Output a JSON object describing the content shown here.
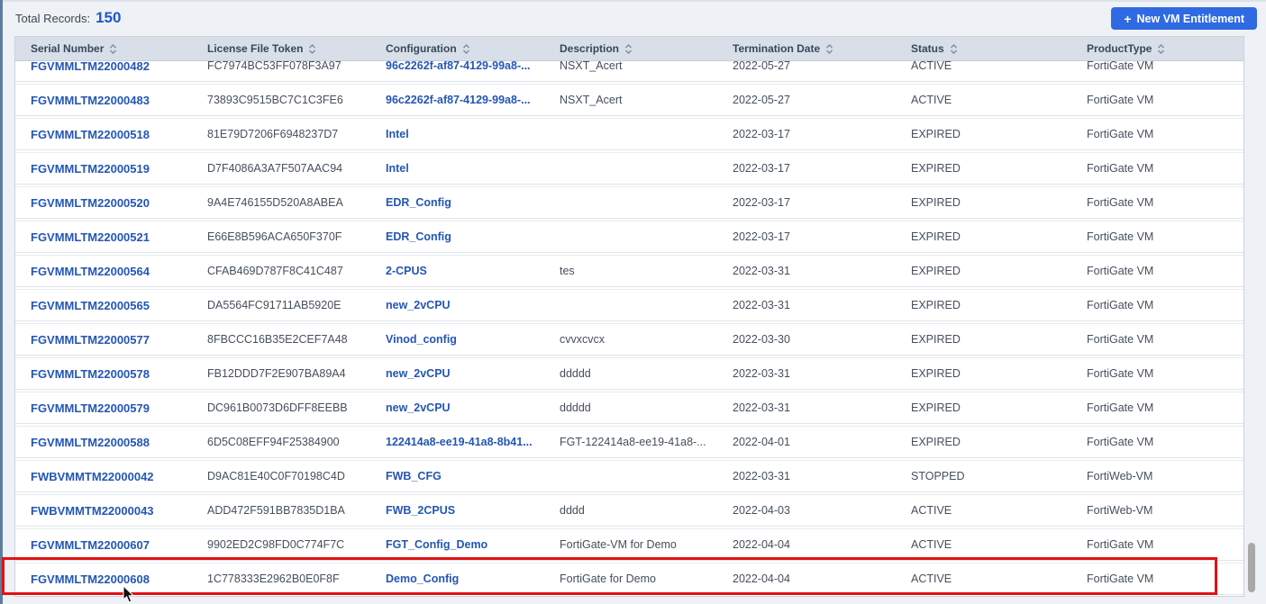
{
  "page": {
    "total_records_label": "Total Records:",
    "total_records_value": "150"
  },
  "toolbar": {
    "new_vm_entitlement_label": "New VM Entitlement"
  },
  "icons": {
    "plus": "+",
    "sort": "sort-updown-icon",
    "cursor": "mouse-arrow-icon"
  },
  "colors": {
    "accent_blue": "#2f6ae3",
    "link_blue": "#2456b4",
    "header_bg": "#d8dfe9",
    "highlight_red": "#e01212",
    "page_bg": "#eef1f5"
  },
  "table": {
    "columns": [
      {
        "key": "serial",
        "label": "Serial Number",
        "sortable": true
      },
      {
        "key": "token",
        "label": "License File Token",
        "sortable": true
      },
      {
        "key": "config",
        "label": "Configuration",
        "sortable": true
      },
      {
        "key": "desc",
        "label": "Description",
        "sortable": true
      },
      {
        "key": "date",
        "label": "Termination Date",
        "sortable": true
      },
      {
        "key": "status",
        "label": "Status",
        "sortable": true
      },
      {
        "key": "product",
        "label": "ProductType",
        "sortable": true
      }
    ],
    "rows": [
      {
        "serial": "FGVMMLTM22000482",
        "token": "FC7974BC53FF078F3A97",
        "config": "96c2262f-af87-4129-99a8-...",
        "desc": "NSXT_Acert",
        "date": "2022-05-27",
        "status": "ACTIVE",
        "product": "FortiGate VM"
      },
      {
        "serial": "FGVMMLTM22000483",
        "token": "73893C9515BC7C1C3FE6",
        "config": "96c2262f-af87-4129-99a8-...",
        "desc": "NSXT_Acert",
        "date": "2022-05-27",
        "status": "ACTIVE",
        "product": "FortiGate VM"
      },
      {
        "serial": "FGVMMLTM22000518",
        "token": "81E79D7206F6948237D7",
        "config": "Intel",
        "desc": "",
        "date": "2022-03-17",
        "status": "EXPIRED",
        "product": "FortiGate VM"
      },
      {
        "serial": "FGVMMLTM22000519",
        "token": "D7F4086A3A7F507AAC94",
        "config": "Intel",
        "desc": "",
        "date": "2022-03-17",
        "status": "EXPIRED",
        "product": "FortiGate VM"
      },
      {
        "serial": "FGVMMLTM22000520",
        "token": "9A4E746155D520A8ABEA",
        "config": "EDR_Config",
        "desc": "",
        "date": "2022-03-17",
        "status": "EXPIRED",
        "product": "FortiGate VM"
      },
      {
        "serial": "FGVMMLTM22000521",
        "token": "E66E8B596ACA650F370F",
        "config": "EDR_Config",
        "desc": "",
        "date": "2022-03-17",
        "status": "EXPIRED",
        "product": "FortiGate VM"
      },
      {
        "serial": "FGVMMLTM22000564",
        "token": "CFAB469D787F8C41C487",
        "config": "2-CPUS",
        "desc": "tes",
        "date": "2022-03-31",
        "status": "EXPIRED",
        "product": "FortiGate VM"
      },
      {
        "serial": "FGVMMLTM22000565",
        "token": "DA5564FC91711AB5920E",
        "config": "new_2vCPU",
        "desc": "",
        "date": "2022-03-31",
        "status": "EXPIRED",
        "product": "FortiGate VM"
      },
      {
        "serial": "FGVMMLTM22000577",
        "token": "8FBCCC16B35E2CEF7A48",
        "config": "Vinod_config",
        "desc": "cvvxcvcx",
        "date": "2022-03-30",
        "status": "EXPIRED",
        "product": "FortiGate VM"
      },
      {
        "serial": "FGVMMLTM22000578",
        "token": "FB12DDD7F2E907BA89A4",
        "config": "new_2vCPU",
        "desc": "ddddd",
        "date": "2022-03-31",
        "status": "EXPIRED",
        "product": "FortiGate VM"
      },
      {
        "serial": "FGVMMLTM22000579",
        "token": "DC961B0073D6DFF8EEBB",
        "config": "new_2vCPU",
        "desc": "ddddd",
        "date": "2022-03-31",
        "status": "EXPIRED",
        "product": "FortiGate VM"
      },
      {
        "serial": "FGVMMLTM22000588",
        "token": "6D5C08EFF94F25384900",
        "config": "122414a8-ee19-41a8-8b41...",
        "desc": "FGT-122414a8-ee19-41a8-...",
        "date": "2022-04-01",
        "status": "EXPIRED",
        "product": "FortiGate VM"
      },
      {
        "serial": "FWBVMMTM22000042",
        "token": "D9AC81E40C0F70198C4D",
        "config": "FWB_CFG",
        "desc": "",
        "date": "2022-03-31",
        "status": "STOPPED",
        "product": "FortiWeb-VM"
      },
      {
        "serial": "FWBVMMTM22000043",
        "token": "ADD472F591BB7835D1BA",
        "config": "FWB_2CPUS",
        "desc": "dddd",
        "date": "2022-04-03",
        "status": "ACTIVE",
        "product": "FortiWeb-VM"
      },
      {
        "serial": "FGVMMLTM22000607",
        "token": "9902ED2C98FD0C774F7C",
        "config": "FGT_Config_Demo",
        "desc": "FortiGate-VM for Demo",
        "date": "2022-04-04",
        "status": "ACTIVE",
        "product": "FortiGate VM"
      },
      {
        "serial": "FGVMMLTM22000608",
        "token": "1C778333E2962B0E0F8F",
        "config": "Demo_Config",
        "desc": "FortiGate for Demo",
        "date": "2022-04-04",
        "status": "ACTIVE",
        "product": "FortiGate VM"
      }
    ],
    "highlighted_row_serial": "FGVMMLTM22000608"
  }
}
